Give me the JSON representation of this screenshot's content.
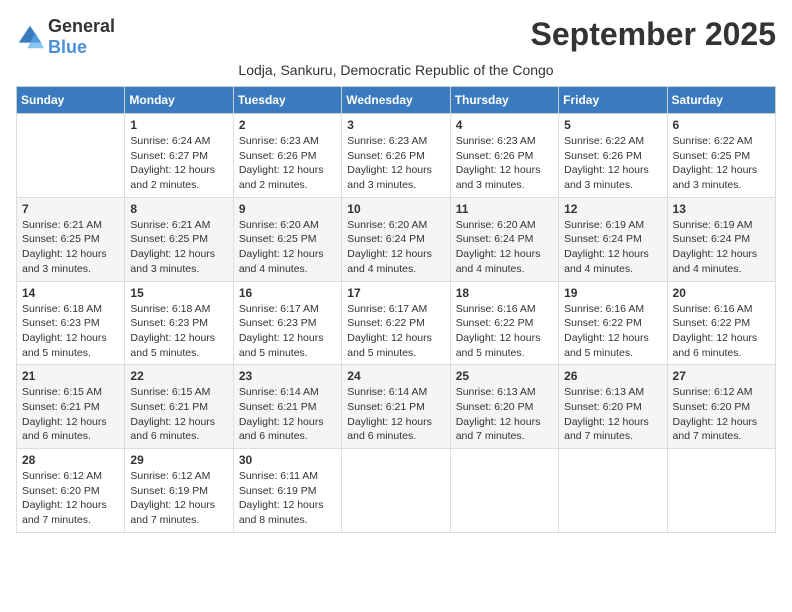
{
  "logo": {
    "general": "General",
    "blue": "Blue"
  },
  "title": "September 2025",
  "subtitle": "Lodja, Sankuru, Democratic Republic of the Congo",
  "days_of_week": [
    "Sunday",
    "Monday",
    "Tuesday",
    "Wednesday",
    "Thursday",
    "Friday",
    "Saturday"
  ],
  "weeks": [
    [
      {
        "day": "",
        "info": ""
      },
      {
        "day": "1",
        "info": "Sunrise: 6:24 AM\nSunset: 6:27 PM\nDaylight: 12 hours\nand 2 minutes."
      },
      {
        "day": "2",
        "info": "Sunrise: 6:23 AM\nSunset: 6:26 PM\nDaylight: 12 hours\nand 2 minutes."
      },
      {
        "day": "3",
        "info": "Sunrise: 6:23 AM\nSunset: 6:26 PM\nDaylight: 12 hours\nand 3 minutes."
      },
      {
        "day": "4",
        "info": "Sunrise: 6:23 AM\nSunset: 6:26 PM\nDaylight: 12 hours\nand 3 minutes."
      },
      {
        "day": "5",
        "info": "Sunrise: 6:22 AM\nSunset: 6:26 PM\nDaylight: 12 hours\nand 3 minutes."
      },
      {
        "day": "6",
        "info": "Sunrise: 6:22 AM\nSunset: 6:25 PM\nDaylight: 12 hours\nand 3 minutes."
      }
    ],
    [
      {
        "day": "7",
        "info": "Sunrise: 6:21 AM\nSunset: 6:25 PM\nDaylight: 12 hours\nand 3 minutes."
      },
      {
        "day": "8",
        "info": "Sunrise: 6:21 AM\nSunset: 6:25 PM\nDaylight: 12 hours\nand 3 minutes."
      },
      {
        "day": "9",
        "info": "Sunrise: 6:20 AM\nSunset: 6:25 PM\nDaylight: 12 hours\nand 4 minutes."
      },
      {
        "day": "10",
        "info": "Sunrise: 6:20 AM\nSunset: 6:24 PM\nDaylight: 12 hours\nand 4 minutes."
      },
      {
        "day": "11",
        "info": "Sunrise: 6:20 AM\nSunset: 6:24 PM\nDaylight: 12 hours\nand 4 minutes."
      },
      {
        "day": "12",
        "info": "Sunrise: 6:19 AM\nSunset: 6:24 PM\nDaylight: 12 hours\nand 4 minutes."
      },
      {
        "day": "13",
        "info": "Sunrise: 6:19 AM\nSunset: 6:24 PM\nDaylight: 12 hours\nand 4 minutes."
      }
    ],
    [
      {
        "day": "14",
        "info": "Sunrise: 6:18 AM\nSunset: 6:23 PM\nDaylight: 12 hours\nand 5 minutes."
      },
      {
        "day": "15",
        "info": "Sunrise: 6:18 AM\nSunset: 6:23 PM\nDaylight: 12 hours\nand 5 minutes."
      },
      {
        "day": "16",
        "info": "Sunrise: 6:17 AM\nSunset: 6:23 PM\nDaylight: 12 hours\nand 5 minutes."
      },
      {
        "day": "17",
        "info": "Sunrise: 6:17 AM\nSunset: 6:22 PM\nDaylight: 12 hours\nand 5 minutes."
      },
      {
        "day": "18",
        "info": "Sunrise: 6:16 AM\nSunset: 6:22 PM\nDaylight: 12 hours\nand 5 minutes."
      },
      {
        "day": "19",
        "info": "Sunrise: 6:16 AM\nSunset: 6:22 PM\nDaylight: 12 hours\nand 5 minutes."
      },
      {
        "day": "20",
        "info": "Sunrise: 6:16 AM\nSunset: 6:22 PM\nDaylight: 12 hours\nand 6 minutes."
      }
    ],
    [
      {
        "day": "21",
        "info": "Sunrise: 6:15 AM\nSunset: 6:21 PM\nDaylight: 12 hours\nand 6 minutes."
      },
      {
        "day": "22",
        "info": "Sunrise: 6:15 AM\nSunset: 6:21 PM\nDaylight: 12 hours\nand 6 minutes."
      },
      {
        "day": "23",
        "info": "Sunrise: 6:14 AM\nSunset: 6:21 PM\nDaylight: 12 hours\nand 6 minutes."
      },
      {
        "day": "24",
        "info": "Sunrise: 6:14 AM\nSunset: 6:21 PM\nDaylight: 12 hours\nand 6 minutes."
      },
      {
        "day": "25",
        "info": "Sunrise: 6:13 AM\nSunset: 6:20 PM\nDaylight: 12 hours\nand 7 minutes."
      },
      {
        "day": "26",
        "info": "Sunrise: 6:13 AM\nSunset: 6:20 PM\nDaylight: 12 hours\nand 7 minutes."
      },
      {
        "day": "27",
        "info": "Sunrise: 6:12 AM\nSunset: 6:20 PM\nDaylight: 12 hours\nand 7 minutes."
      }
    ],
    [
      {
        "day": "28",
        "info": "Sunrise: 6:12 AM\nSunset: 6:20 PM\nDaylight: 12 hours\nand 7 minutes."
      },
      {
        "day": "29",
        "info": "Sunrise: 6:12 AM\nSunset: 6:19 PM\nDaylight: 12 hours\nand 7 minutes."
      },
      {
        "day": "30",
        "info": "Sunrise: 6:11 AM\nSunset: 6:19 PM\nDaylight: 12 hours\nand 8 minutes."
      },
      {
        "day": "",
        "info": ""
      },
      {
        "day": "",
        "info": ""
      },
      {
        "day": "",
        "info": ""
      },
      {
        "day": "",
        "info": ""
      }
    ]
  ]
}
